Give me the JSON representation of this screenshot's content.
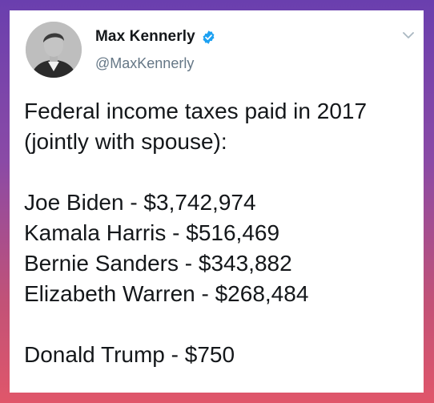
{
  "colors": {
    "name": "#14171a",
    "handle": "#657786",
    "verified": "#1da1f2",
    "card": "#ffffff"
  },
  "author": {
    "display_name": "Max Kennerly",
    "handle": "@MaxKennerly",
    "verified_icon": "verified-badge-icon",
    "avatar_icon": "profile-photo"
  },
  "menu": {
    "icon": "chevron-down-icon"
  },
  "tweet": {
    "intro_line_1": "Federal income taxes paid in 2017",
    "intro_line_2": "(jointly with spouse):",
    "entries": [
      "Joe Biden - $3,742,974",
      "Kamala Harris - $516,469",
      "Bernie Sanders - $343,882",
      "Elizabeth Warren - $268,484"
    ],
    "closing": "Donald Trump - $750"
  }
}
